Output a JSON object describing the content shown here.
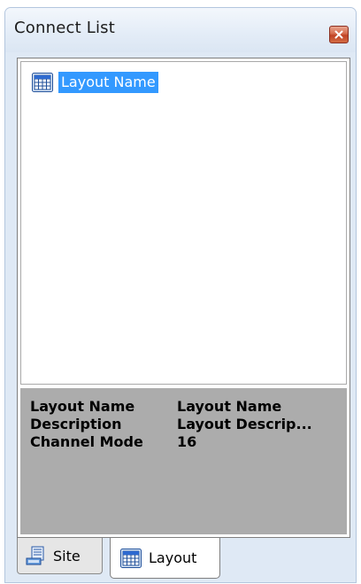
{
  "window": {
    "title": "Connect List"
  },
  "tree": {
    "items": [
      {
        "label": "Layout Name",
        "icon": "grid-layout-icon",
        "selected": true
      }
    ]
  },
  "info": {
    "rows": [
      {
        "key": "Layout Name",
        "value": "Layout Name"
      },
      {
        "key": "Description",
        "value": "Layout Descrip..."
      },
      {
        "key": "Channel Mode",
        "value": "16"
      }
    ]
  },
  "tabs": [
    {
      "label": "Site",
      "icon": "site-icon",
      "active": false
    },
    {
      "label": "Layout",
      "icon": "grid-layout-icon",
      "active": true
    }
  ],
  "colors": {
    "selection": "#3399ff",
    "info_bg": "#acacac",
    "close_button": "#c04325"
  }
}
